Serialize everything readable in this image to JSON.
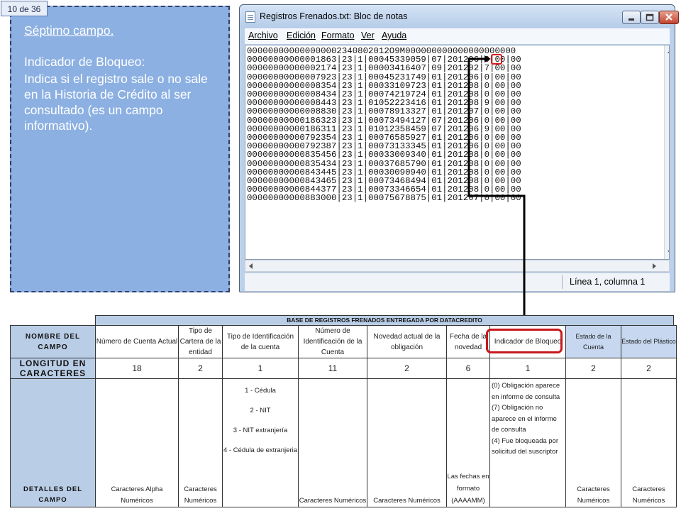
{
  "slide": {
    "counter": "10 de 36"
  },
  "info_panel": {
    "title": "Séptimo campo.",
    "subtitle": "Indicador de Bloqueo:",
    "body": "Indica si el registro sale o no sale en la Historia de Crédito al ser consultado (es un campo informativo)."
  },
  "notepad": {
    "title": "Registros Frenados.txt: Bloc de notas",
    "menu": [
      "Archivo",
      "Edición",
      "Formato",
      "Ver",
      "Ayuda"
    ],
    "lines": [
      "000000000000000002340802012O9M000000000000000000000",
      "00000000000001863|23|1|00045339059|07|201206|0|00|00",
      "00000000000002174|23|1|00003416407|09|201202|7|00|00",
      "00000000000007923|23|1|00045231749|01|201206|0|00|00",
      "00000000000008354|23|1|00033109723|01|201208|0|00|00",
      "00000000000008434|23|1|00074219724|01|201208|0|00|00",
      "00000000000008443|23|1|01052223416|01|201208|9|00|00",
      "00000000000008830|23|1|00078913327|01|201207|0|00|00",
      "00000000000186323|23|1|00073494127|07|201206|0|00|00",
      "00000000000186311|23|1|01012358459|07|201206|9|00|00",
      "00000000000792354|23|1|00076585927|01|201206|0|00|00",
      "00000000000792387|23|1|00073133345|01|201206|0|00|00",
      "00000000000835456|23|1|00033009340|01|201208|0|00|00",
      "00000000000835434|23|1|00037685790|01|201208|0|00|00",
      "00000000000843445|23|1|00030090940|01|201208|0|00|00",
      "00000000000843465|23|1|00073468494|01|201208|0|00|00",
      "00000000000844377|23|1|00073346654|01|201208|0|00|00",
      "00000000000883000|23|1|00075678875|01|201207|0|00|00"
    ],
    "status": "Línea 1, columna 1"
  },
  "table": {
    "header": "BASE DE REGISTROS FRENADOS ENTREGADA POR DATACREDITO",
    "row_labels": {
      "name": "NOMBRE DEL CAMPO",
      "length": "LONGITUD EN CARACTERES",
      "details": "DETALLES DEL CAMPO"
    },
    "columns": [
      {
        "name": "Número de Cuenta Actual",
        "length": "18",
        "details": "Caracteres Alpha Numéricos"
      },
      {
        "name": "Tipo de Cartera de la entidad",
        "length": "2",
        "details": "Caracteres Numéricos"
      },
      {
        "name": "Tipo de Identificación de la cuenta",
        "length": "1",
        "details": [
          "1 - Cédula",
          "2 - NIT",
          "3 - NIT extranjería",
          "4 - Cédula de extranjeria"
        ]
      },
      {
        "name": "Número de Identificación de la Cuenta",
        "length": "11",
        "details": "Caracteres Numéricos"
      },
      {
        "name": "Novedad actual de la obligación",
        "length": "2",
        "details": "Caracteres Numéricos"
      },
      {
        "name": "Fecha de la novedad",
        "length": "6",
        "details": "Las fechas en formato (AAAAMM)"
      },
      {
        "name": "Indicador de Bloqueo",
        "length": "1",
        "details": [
          "(0) Obligación aparece en informe de consulta",
          "(7) Obligación no aparece en el informe de consulta",
          "(4) Fue bloqueada por solicitud del suscriptor"
        ]
      },
      {
        "name": "Estado de la Cuenta",
        "length": "2",
        "details": "Caracteres Numéricos"
      },
      {
        "name": "Estado del Plástico",
        "length": "2",
        "details": "Caracteres Numéricos"
      }
    ]
  },
  "colors": {
    "panel": "#8cb0e2",
    "table_header": "#b9cde6",
    "highlight": "#d81818"
  }
}
